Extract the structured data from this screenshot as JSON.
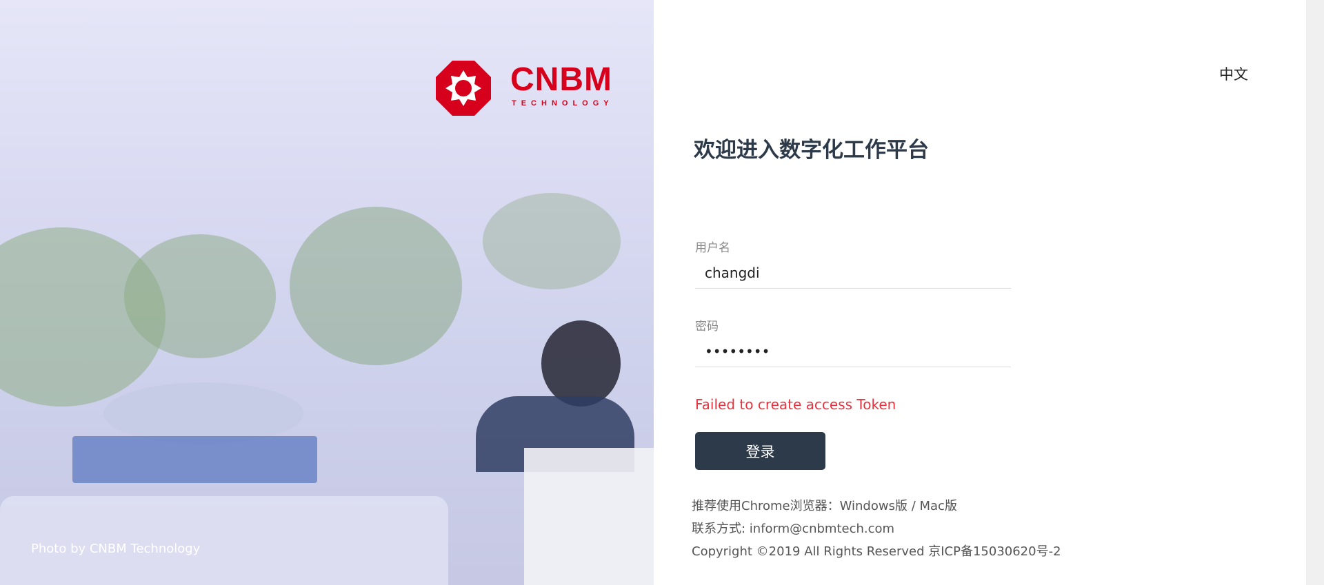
{
  "brand": {
    "logo_text": "CNBM",
    "logo_subtext": "TECHNOLOGY",
    "color": "#d6001c",
    "photo_credit": "Photo by CNBM Technology"
  },
  "login": {
    "language_switch": "中文",
    "title": "欢迎进入数字化工作平台",
    "username_label": "用户名",
    "username_value": "changdi",
    "password_label": "密码",
    "password_value": "changdi1",
    "error_message": "Failed to create access Token",
    "submit_label": "登录",
    "button_color": "#2d3a4a",
    "error_color": "#e8333f"
  },
  "footer": {
    "browser_prefix": "推荐使用Chrome浏览器：",
    "windows_link": "Windows版",
    "separator": " / ",
    "mac_link": "Mac版",
    "contact_prefix": "联系方式: ",
    "contact_email": "inform@cnbmtech.com",
    "copyright": "Copyright ©2019 All Rights Reserved 京ICP备15030620号-2"
  }
}
